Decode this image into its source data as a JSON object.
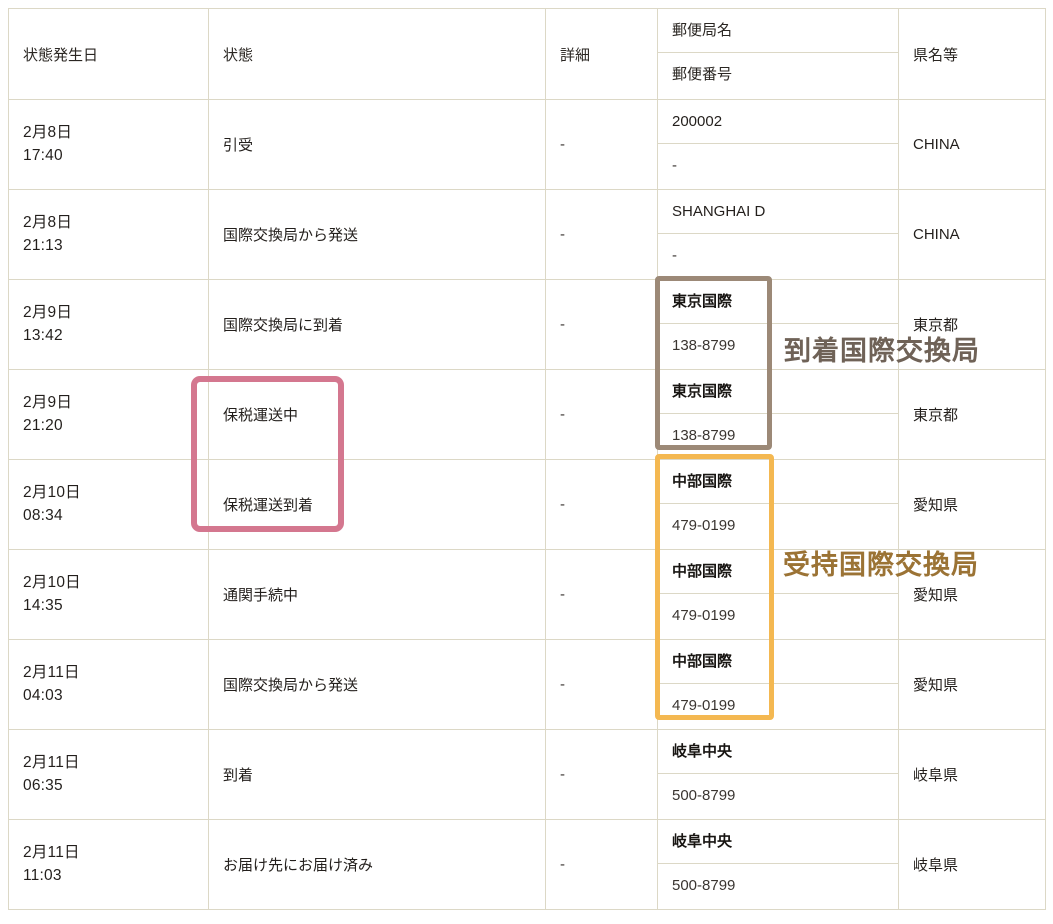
{
  "table": {
    "headers": {
      "date": "状態発生日",
      "status": "状態",
      "detail": "詳細",
      "office_name": "郵便局名",
      "office_code": "郵便番号",
      "prefecture": "県名等"
    },
    "rows": [
      {
        "date": "2月8日",
        "time": "17:40",
        "status": "引受",
        "detail": "-",
        "office_name": "200002",
        "office_code": "-",
        "prefecture": "CHINA",
        "office_bold": false
      },
      {
        "date": "2月8日",
        "time": "21:13",
        "status": "国際交換局から発送",
        "detail": "-",
        "office_name": "SHANGHAI D",
        "office_code": "-",
        "prefecture": "CHINA",
        "office_bold": false
      },
      {
        "date": "2月9日",
        "time": "13:42",
        "status": "国際交換局に到着",
        "detail": "-",
        "office_name": "東京国際",
        "office_code": "138-8799",
        "prefecture": "東京都",
        "office_bold": true
      },
      {
        "date": "2月9日",
        "time": "21:20",
        "status": "保税運送中",
        "detail": "-",
        "office_name": "東京国際",
        "office_code": "138-8799",
        "prefecture": "東京都",
        "office_bold": true
      },
      {
        "date": "2月10日",
        "time": "08:34",
        "status": "保税運送到着",
        "detail": "-",
        "office_name": "中部国際",
        "office_code": "479-0199",
        "prefecture": "愛知県",
        "office_bold": true
      },
      {
        "date": "2月10日",
        "time": "14:35",
        "status": "通関手続中",
        "detail": "-",
        "office_name": "中部国際",
        "office_code": "479-0199",
        "prefecture": "愛知県",
        "office_bold": true
      },
      {
        "date": "2月11日",
        "time": "04:03",
        "status": "国際交換局から発送",
        "detail": "-",
        "office_name": "中部国際",
        "office_code": "479-0199",
        "prefecture": "愛知県",
        "office_bold": true
      },
      {
        "date": "2月11日",
        "time": "06:35",
        "status": "到着",
        "detail": "-",
        "office_name": "岐阜中央",
        "office_code": "500-8799",
        "prefecture": "岐阜県",
        "office_bold": true
      },
      {
        "date": "2月11日",
        "time": "11:03",
        "status": "お届け先にお届け済み",
        "detail": "-",
        "office_name": "岐阜中央",
        "office_code": "500-8799",
        "prefecture": "岐阜県",
        "office_bold": true
      }
    ]
  },
  "annotations": {
    "arrival_exchange": "到着国際交換局",
    "receipt_exchange": "受持国際交換局"
  },
  "colors": {
    "header_bg": "#f2f0e4",
    "grid_line": "#dcd8c6",
    "highlight_pink": "#d4778f",
    "highlight_gray": "#9c8977",
    "highlight_orange": "#f4b851",
    "anno_arrival_text": "#6f6257",
    "anno_receipt_text": "#9b7335"
  }
}
